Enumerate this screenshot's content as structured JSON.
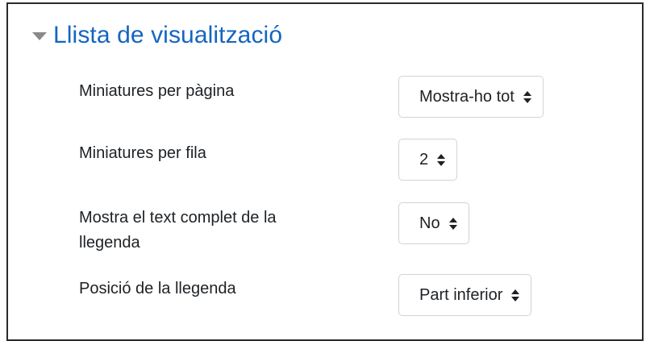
{
  "section": {
    "title": "Llista de visualització",
    "collapse_icon": "caret-down-icon"
  },
  "settings": [
    {
      "label": "Miniatures per pàgina",
      "value": "Mostra-ho tot"
    },
    {
      "label": "Miniatures per fila",
      "value": "2"
    },
    {
      "label": "Mostra el text complet de la llegenda",
      "value": "No"
    },
    {
      "label": "Posició de la llegenda",
      "value": "Part inferior"
    }
  ],
  "colors": {
    "title": "#1565c0",
    "text": "#1d2125",
    "border": "#ced4da"
  }
}
